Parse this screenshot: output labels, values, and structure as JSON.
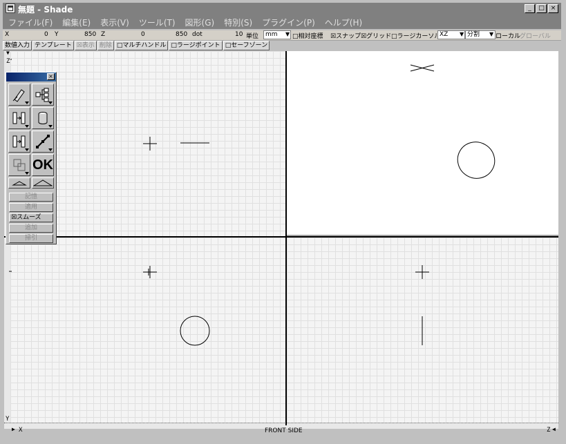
{
  "window": {
    "title": "無題 - Shade"
  },
  "window_buttons": {
    "minimize": "_",
    "maximize": "□",
    "close": "×"
  },
  "menu": [
    "ファイル(F)",
    "編集(E)",
    "表示(V)",
    "ツール(T)",
    "図形(G)",
    "特別(S)",
    "プラグイン(P)",
    "ヘルプ(H)"
  ],
  "coords": {
    "x_label": "X",
    "x_value": "0",
    "y_label": "Y",
    "y_value": "850",
    "z_label": "Z",
    "z_value": "0",
    "dot_value": "850",
    "dot_label": "dot",
    "unit_value": "10",
    "unit_label": "単位",
    "unit_select": "mm",
    "relative_coords": "□相対座標",
    "snap": "☒スナップ",
    "grid": "☒グリッド",
    "large_cursor": "□ラージカーソル",
    "plane_select": "XZ",
    "split_select": "分割",
    "local": "ローカル",
    "global": "グローバル"
  },
  "toolbar2": {
    "numeric_input": "数値入力",
    "template": "テンプレート",
    "show": "☒表示",
    "delete": "削除",
    "multi_handle": "□マルチハンドル",
    "large_point": "□ラージポイント",
    "safe_zone": "□セーフゾーン"
  },
  "palette": {
    "ok_label": "OK",
    "memory": "記憶",
    "apply": "適用",
    "smooth": "☒スムーズ",
    "add": "追加",
    "subtract": "掃引",
    "tools": [
      "pencil-icon",
      "hierarchy-icon",
      "move-into-icon",
      "cylinder-icon",
      "move-into-icon",
      "line-point-icon",
      "copy-icon",
      "ok-icon",
      "mountain-small-icon",
      "mountain-large-icon"
    ]
  },
  "axes": {
    "top_left_z": "Z",
    "bottom_left_y": "Y",
    "bottom_x": "X",
    "bottom_right_z": "Z"
  },
  "view_label": "FRONT SIDE",
  "colors": {
    "titlebar": "#808080",
    "palette_title": "#0a246a",
    "active_viewport": "#ffffff"
  }
}
